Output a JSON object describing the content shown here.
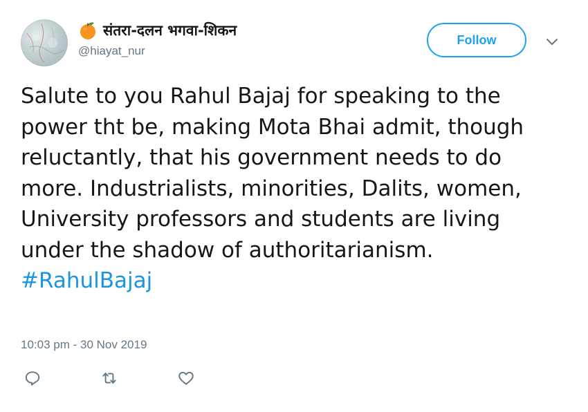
{
  "user": {
    "display_name": "संतरा-दलन भगवा-शिकन",
    "handle": "@hiayat_nur",
    "name_icon": "orange-emoji-icon",
    "avatar_icon": "avatar-image"
  },
  "header": {
    "follow_label": "Follow",
    "menu_icon": "chevron-down-icon"
  },
  "tweet": {
    "text": "Salute to you Rahul Bajaj for speaking to the power tht be, making Mota Bhai admit, though reluctantly, that his government needs to do more. Industrialists, minorities, Dalits, women, University professors and students are living under the shadow of authoritarianism.",
    "hashtag": "#RahulBajaj",
    "timestamp": "10:03 pm - 30 Nov 2019"
  },
  "actions": {
    "reply_icon": "reply-icon",
    "retweet_icon": "retweet-icon",
    "like_icon": "heart-icon"
  },
  "colors": {
    "accent": "#1da1f2",
    "hashtag": "#1b95e0",
    "muted": "#657786",
    "text": "#14171a"
  }
}
